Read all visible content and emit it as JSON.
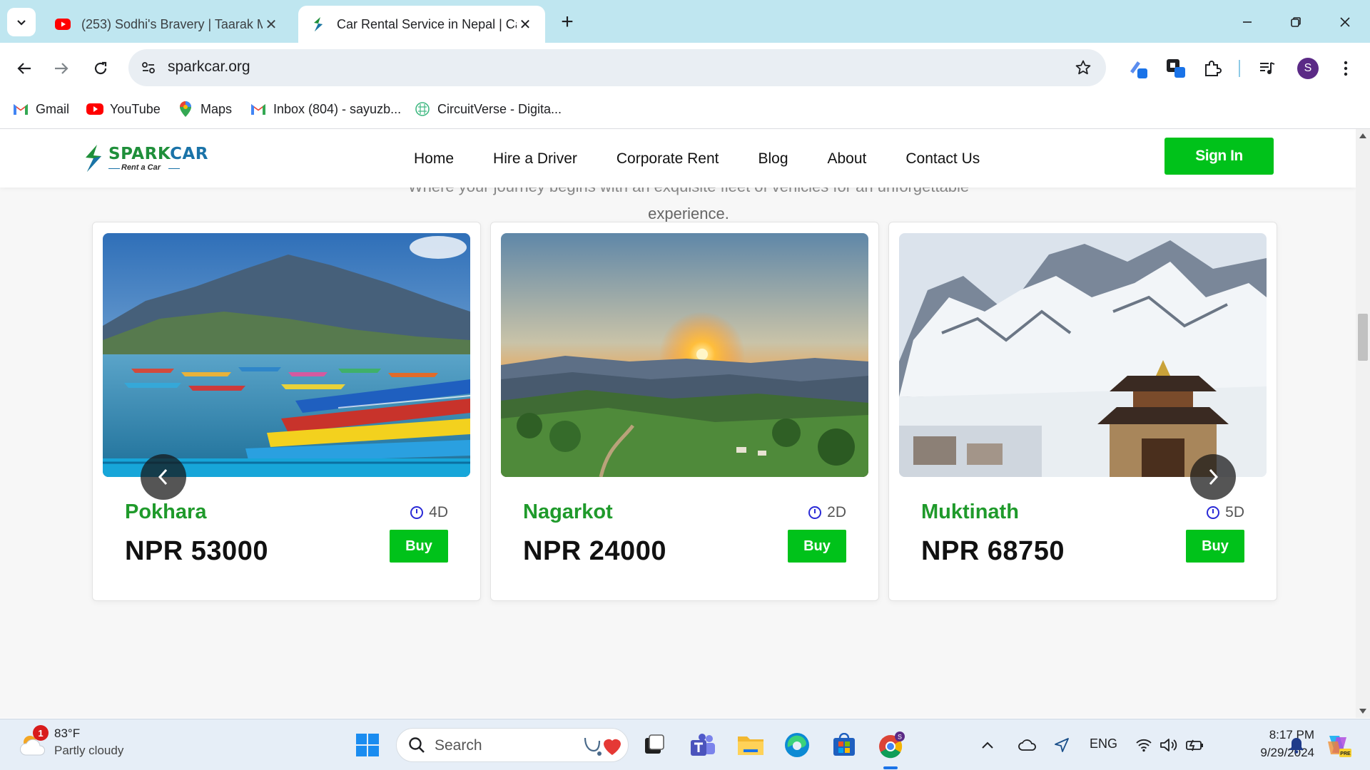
{
  "browser": {
    "tabs": [
      {
        "title": "(253) Sodhi's Bravery | Taarak M",
        "favicon": "youtube-icon",
        "active": false
      },
      {
        "title": "Car Rental Service in Nepal | Ca",
        "favicon": "sparkcar-icon",
        "active": true
      }
    ],
    "address": {
      "url": "sparkcar.org"
    },
    "profile_initial": "S",
    "bookmarks": [
      {
        "label": "Gmail",
        "icon": "gmail-icon"
      },
      {
        "label": "YouTube",
        "icon": "youtube-icon"
      },
      {
        "label": "Maps",
        "icon": "maps-icon"
      },
      {
        "label": "Inbox (804) - sayuzb...",
        "icon": "gmail-icon"
      },
      {
        "label": "CircuitVerse - Digita...",
        "icon": "circuitverse-icon"
      }
    ]
  },
  "site": {
    "logo": {
      "brand_a": "SPARK",
      "brand_b": "CAR",
      "tagline": "Rent a Car"
    },
    "nav": [
      "Home",
      "Hire a Driver",
      "Corporate Rent",
      "Blog",
      "About",
      "Contact Us"
    ],
    "signin_label": "Sign In",
    "subtitle_line1": "Where your journey begins with an exquisite fleet of vehicles for an unforgettable",
    "subtitle_line2": "experience.",
    "cards": [
      {
        "place": "Pokhara",
        "duration": "4D",
        "price": "NPR 53000",
        "buy_label": "Buy",
        "image": "lake-boats"
      },
      {
        "place": "Nagarkot",
        "duration": "2D",
        "price": "NPR 24000",
        "buy_label": "Buy",
        "image": "sunset-hills"
      },
      {
        "place": "Muktinath",
        "duration": "5D",
        "price": "NPR 68750",
        "buy_label": "Buy",
        "image": "snow-temple"
      }
    ],
    "colors": {
      "accent": "#00c21a",
      "place_text": "#1f9a2b",
      "brand_blue": "#1a73a8"
    }
  },
  "taskbar": {
    "weather": {
      "temp": "83°F",
      "condition": "Partly cloudy",
      "badge": "1"
    },
    "search_placeholder": "Search",
    "tray": {
      "language": "ENG"
    },
    "time": "8:17 PM",
    "date": "9/29/2024"
  }
}
